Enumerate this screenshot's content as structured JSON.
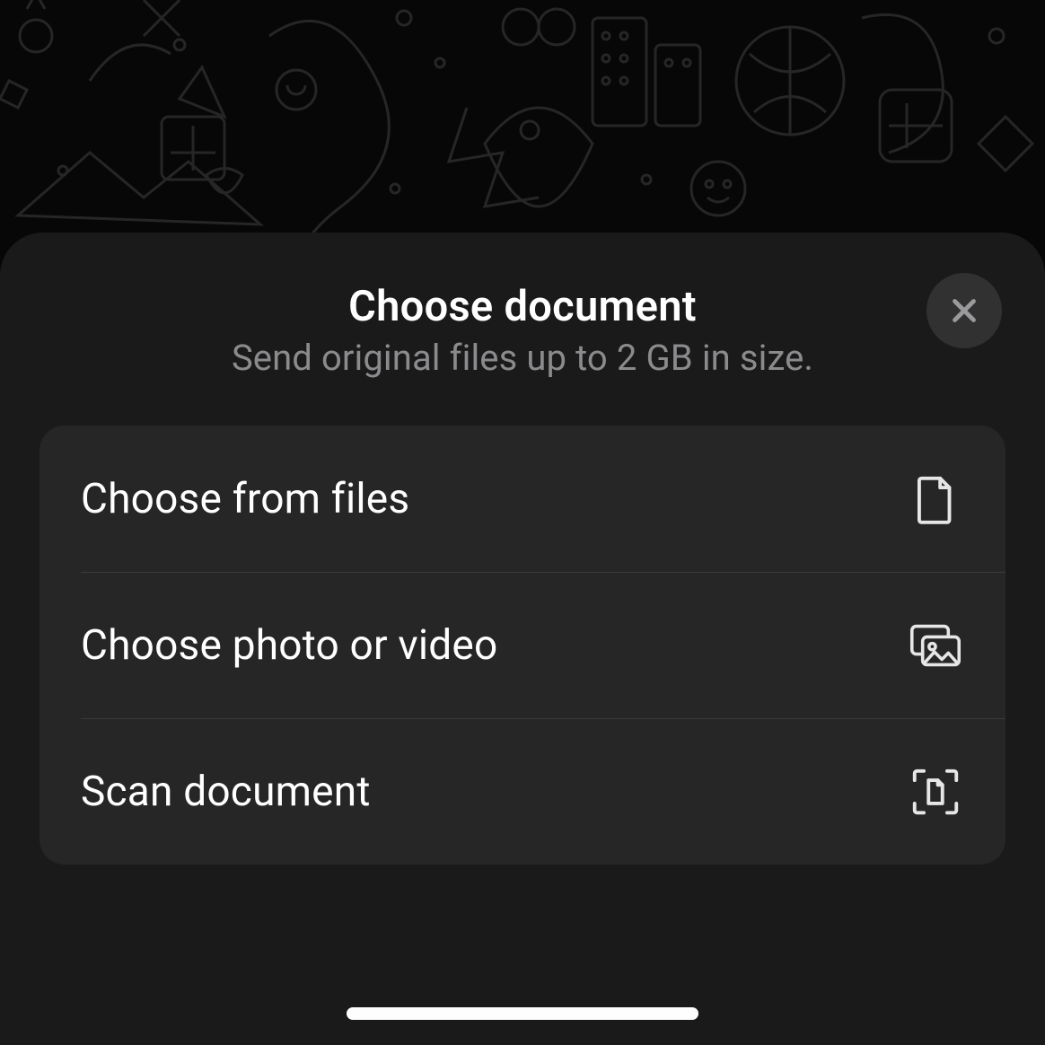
{
  "sheet": {
    "title": "Choose document",
    "subtitle": "Send original files up to 2 GB in size."
  },
  "menu": {
    "items": [
      {
        "label": "Choose from files"
      },
      {
        "label": "Choose photo or video"
      },
      {
        "label": "Scan document"
      }
    ]
  }
}
